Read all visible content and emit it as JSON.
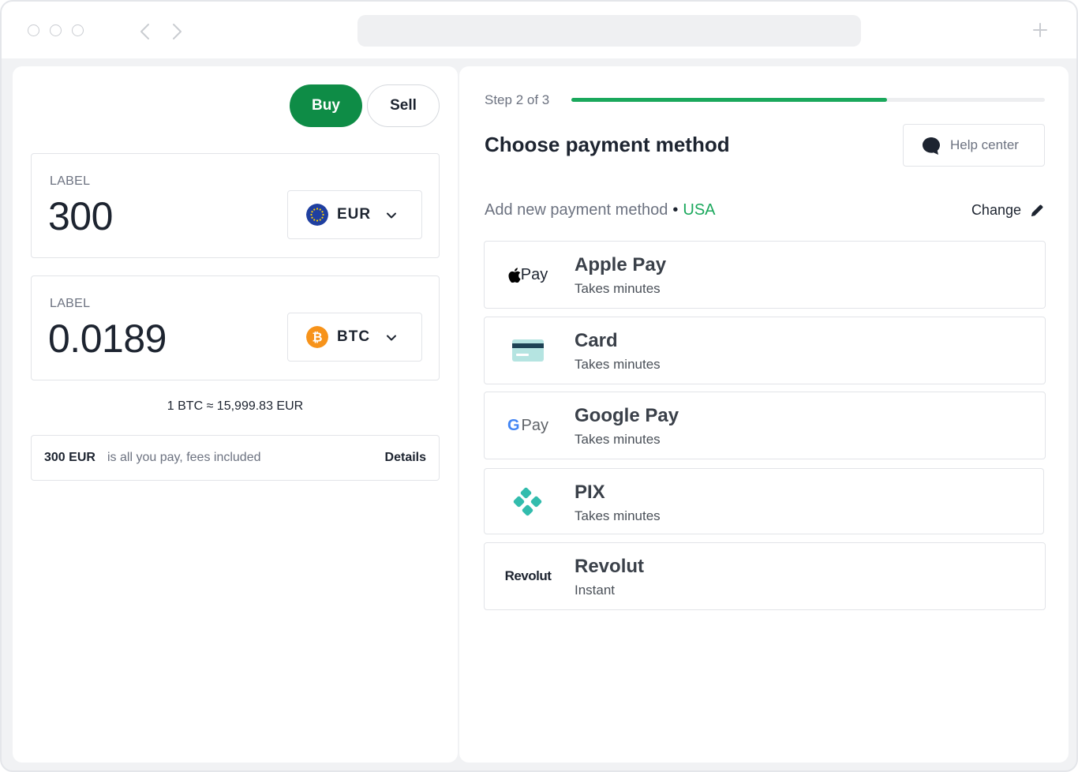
{
  "trade": {
    "buy_label": "Buy",
    "sell_label": "Sell",
    "from": {
      "label": "LABEL",
      "value": "300",
      "currency": "EUR"
    },
    "to": {
      "label": "LABEL",
      "value": "0.0189",
      "currency": "BTC"
    },
    "rate": "1 BTC ≈ 15,999.83 EUR",
    "fee": {
      "amount": "300 EUR",
      "text": "is all you pay, fees included",
      "details_label": "Details"
    }
  },
  "payment": {
    "step_text": "Step 2 of 3",
    "progress": 0.667,
    "title": "Choose payment method",
    "help_label": "Help center",
    "add_method_text": "Add new payment method",
    "country": "USA",
    "change_label": "Change",
    "methods": [
      {
        "name": "Apple Pay",
        "subtitle": "Takes minutes",
        "logo": "apple-pay-logo",
        "logo_text": "Pay"
      },
      {
        "name": "Card",
        "subtitle": "Takes minutes",
        "logo": "card-icon"
      },
      {
        "name": "Google Pay",
        "subtitle": "Takes minutes",
        "logo": "google-pay-logo",
        "logo_text": "Pay",
        "logo_letter": "G"
      },
      {
        "name": "PIX",
        "subtitle": "Takes minutes",
        "logo": "pix-icon"
      },
      {
        "name": "Revolut",
        "subtitle": "Instant",
        "logo": "revolut-logo",
        "logo_text": "Revolut"
      }
    ]
  },
  "colors": {
    "accent_green": "#0e8c46",
    "progress_green": "#1aa85c",
    "bitcoin_orange": "#f7931a",
    "eu_blue": "#1f3fa0"
  }
}
